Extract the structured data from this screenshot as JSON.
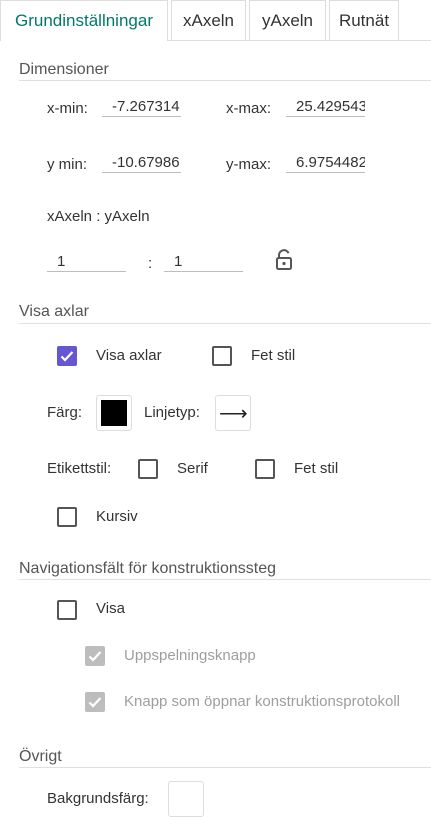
{
  "tabs": [
    {
      "label": "Grundinställningar",
      "active": true
    },
    {
      "label": "xAxeln",
      "active": false
    },
    {
      "label": "yAxeln",
      "active": false
    },
    {
      "label": "Rutnät",
      "active": false
    }
  ],
  "dimensions": {
    "heading": "Dimensioner",
    "xmin_label": "x-min:",
    "xmin_value": "-7.267314",
    "xmax_label": "x-max:",
    "xmax_value": "25.429543",
    "ymin_label": "y min:",
    "ymin_value": "-10.67986",
    "ymax_label": "y-max:",
    "ymax_value": "6.9754482",
    "ratio_label": "xAxeln : yAxeln",
    "ratio_x": "1",
    "ratio_sep": ":",
    "ratio_y": "1"
  },
  "show_axes": {
    "heading": "Visa axlar",
    "show_label": "Visa axlar",
    "show_checked": true,
    "bold_label": "Fet stil",
    "bold_checked": false,
    "color_label": "Färg:",
    "color_value": "#000000",
    "linetype_label": "Linjetyp:",
    "linetype_glyph": "⟶",
    "labelstyle_label": "Etikettstil:",
    "serif_label": "Serif",
    "serif_checked": false,
    "fet_label": "Fet stil",
    "fet_checked": false,
    "italic_label": "Kursiv",
    "italic_checked": false
  },
  "navigation": {
    "heading": "Navigationsfält för konstruktionssteg",
    "show_label": "Visa",
    "show_checked": false,
    "play_label": "Uppspelningsknapp",
    "play_checked": true,
    "protocol_label": "Knapp som öppnar konstruktionsprotokoll",
    "protocol_checked": true
  },
  "other": {
    "heading": "Övrigt",
    "bg_label": "Bakgrundsfärg:",
    "bg_color": "#ffffff"
  },
  "colors": {
    "accent": "#6557d2",
    "active_tab": "#00796b",
    "disabled": "#bdbdbd"
  }
}
